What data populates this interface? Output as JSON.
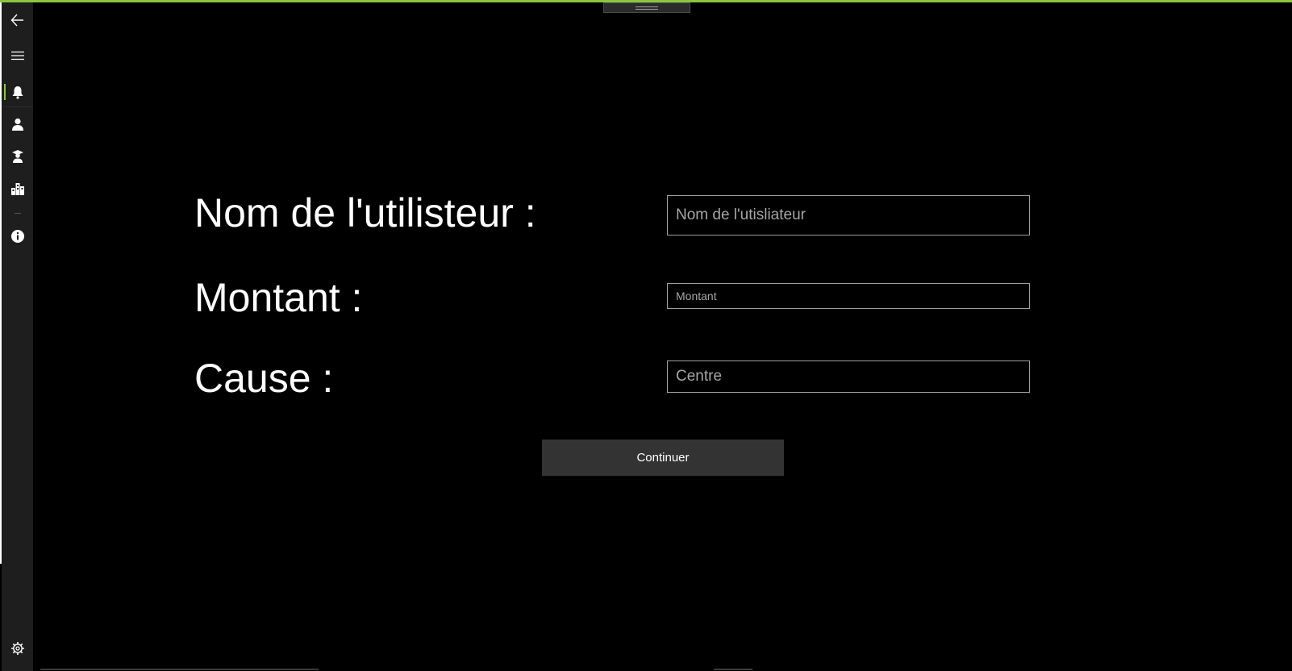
{
  "colors": {
    "accent": "#8cc63f",
    "background": "#000000",
    "nav_pane": "#1e1e1e",
    "button": "#333333",
    "input_border": "#9e9e9e"
  },
  "nav": {
    "back_icon": "back-arrow-icon",
    "menu_icon": "hamburger-menu-icon",
    "items": [
      {
        "icon": "user-bell-icon",
        "selected": true
      },
      {
        "icon": "person-icon",
        "selected": false
      },
      {
        "icon": "graduate-icon",
        "selected": false
      },
      {
        "icon": "building-icon",
        "selected": false
      }
    ],
    "info_icon": "info-icon",
    "settings_icon": "settings-gear-icon"
  },
  "form": {
    "username": {
      "label": "Nom de l'utilisteur :",
      "placeholder": "Nom de l'utisliateur",
      "value": ""
    },
    "amount": {
      "label": "Montant :",
      "placeholder": "Montant",
      "value": ""
    },
    "cause": {
      "label": "Cause :",
      "placeholder": "Centre",
      "value": ""
    },
    "submit_label": "Continuer"
  }
}
